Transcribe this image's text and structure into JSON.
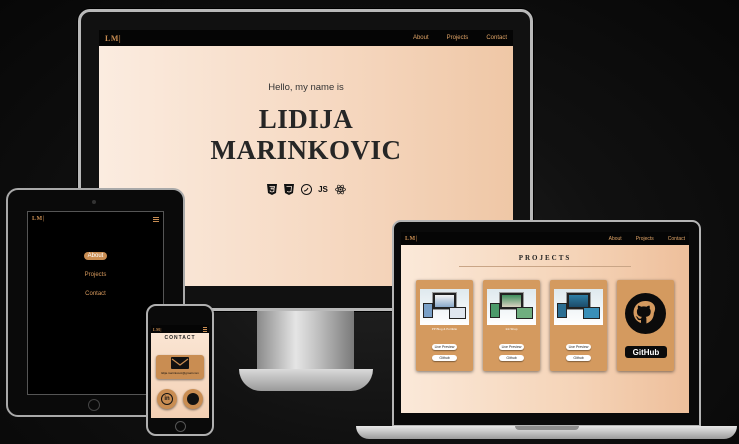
{
  "desktop": {
    "logo": "LM|",
    "nav": [
      "About",
      "Projects",
      "Contact"
    ],
    "greeting": "Hello, my name is",
    "name_line1": "LIDIJA",
    "name_line2": "MARINKOVIC",
    "skills": [
      "html5-icon",
      "css3-icon",
      "sass-icon",
      "JS",
      "react-icon"
    ],
    "skill_js": "JS"
  },
  "tablet": {
    "logo": "LM|",
    "menu": [
      "About",
      "Projects",
      "Contact"
    ]
  },
  "phone": {
    "logo": "LM|",
    "title": "CONTACT",
    "email": "lidija.marinkovic@gmail.com"
  },
  "laptop": {
    "logo": "LM|",
    "nav": [
      "About",
      "Projects",
      "Contact"
    ],
    "section_title": "PROJECTS",
    "cards": [
      {
        "caption": "PP Blog & Portfolio",
        "live": "Live Preview",
        "github": "Github"
      },
      {
        "caption": "Ink Shop",
        "live": "Live Preview",
        "github": "Github"
      },
      {
        "caption": "",
        "live": "Live Preview",
        "github": "Github"
      }
    ],
    "github_label": "GitHub"
  },
  "colors": {
    "accent": "#c98d52",
    "bg_gradient_start": "#fbece0",
    "bg_gradient_end": "#efc7a6"
  }
}
